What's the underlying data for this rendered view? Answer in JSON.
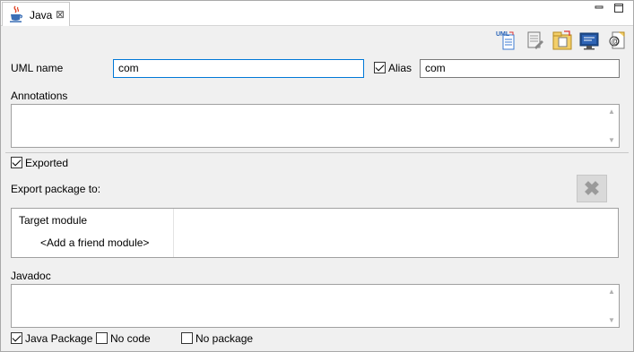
{
  "tab": {
    "title": "Java",
    "close_glyph": "⊠",
    "icon": "java-cup-icon"
  },
  "window_controls": {
    "minimize": "▭",
    "maximize": "☐"
  },
  "toolbar": {
    "icons": [
      "uml-document-icon",
      "edit-document-icon",
      "folder-document-icon",
      "monitor-icon",
      "annotation-document-icon"
    ],
    "uml_badge": "UML"
  },
  "form": {
    "uml_name_label": "UML name",
    "uml_name_value": "com",
    "alias_label": "Alias",
    "alias_checked": true,
    "alias_value": "com",
    "annotations_label": "Annotations",
    "exported_label": "Exported",
    "exported_checked": true,
    "export_package_label": "Export package to:",
    "delete_glyph": "✖",
    "table": {
      "header": "Target module",
      "placeholder_row": "<Add a friend module>"
    },
    "javadoc_label": "Javadoc",
    "java_package_label": "Java Package",
    "java_package_checked": true,
    "no_code_label": "No code",
    "no_code_checked": false,
    "no_package_label": "No package",
    "no_package_checked": false
  },
  "colors": {
    "focus_border": "#0078d7",
    "panel_bg": "#f0f0f0"
  }
}
